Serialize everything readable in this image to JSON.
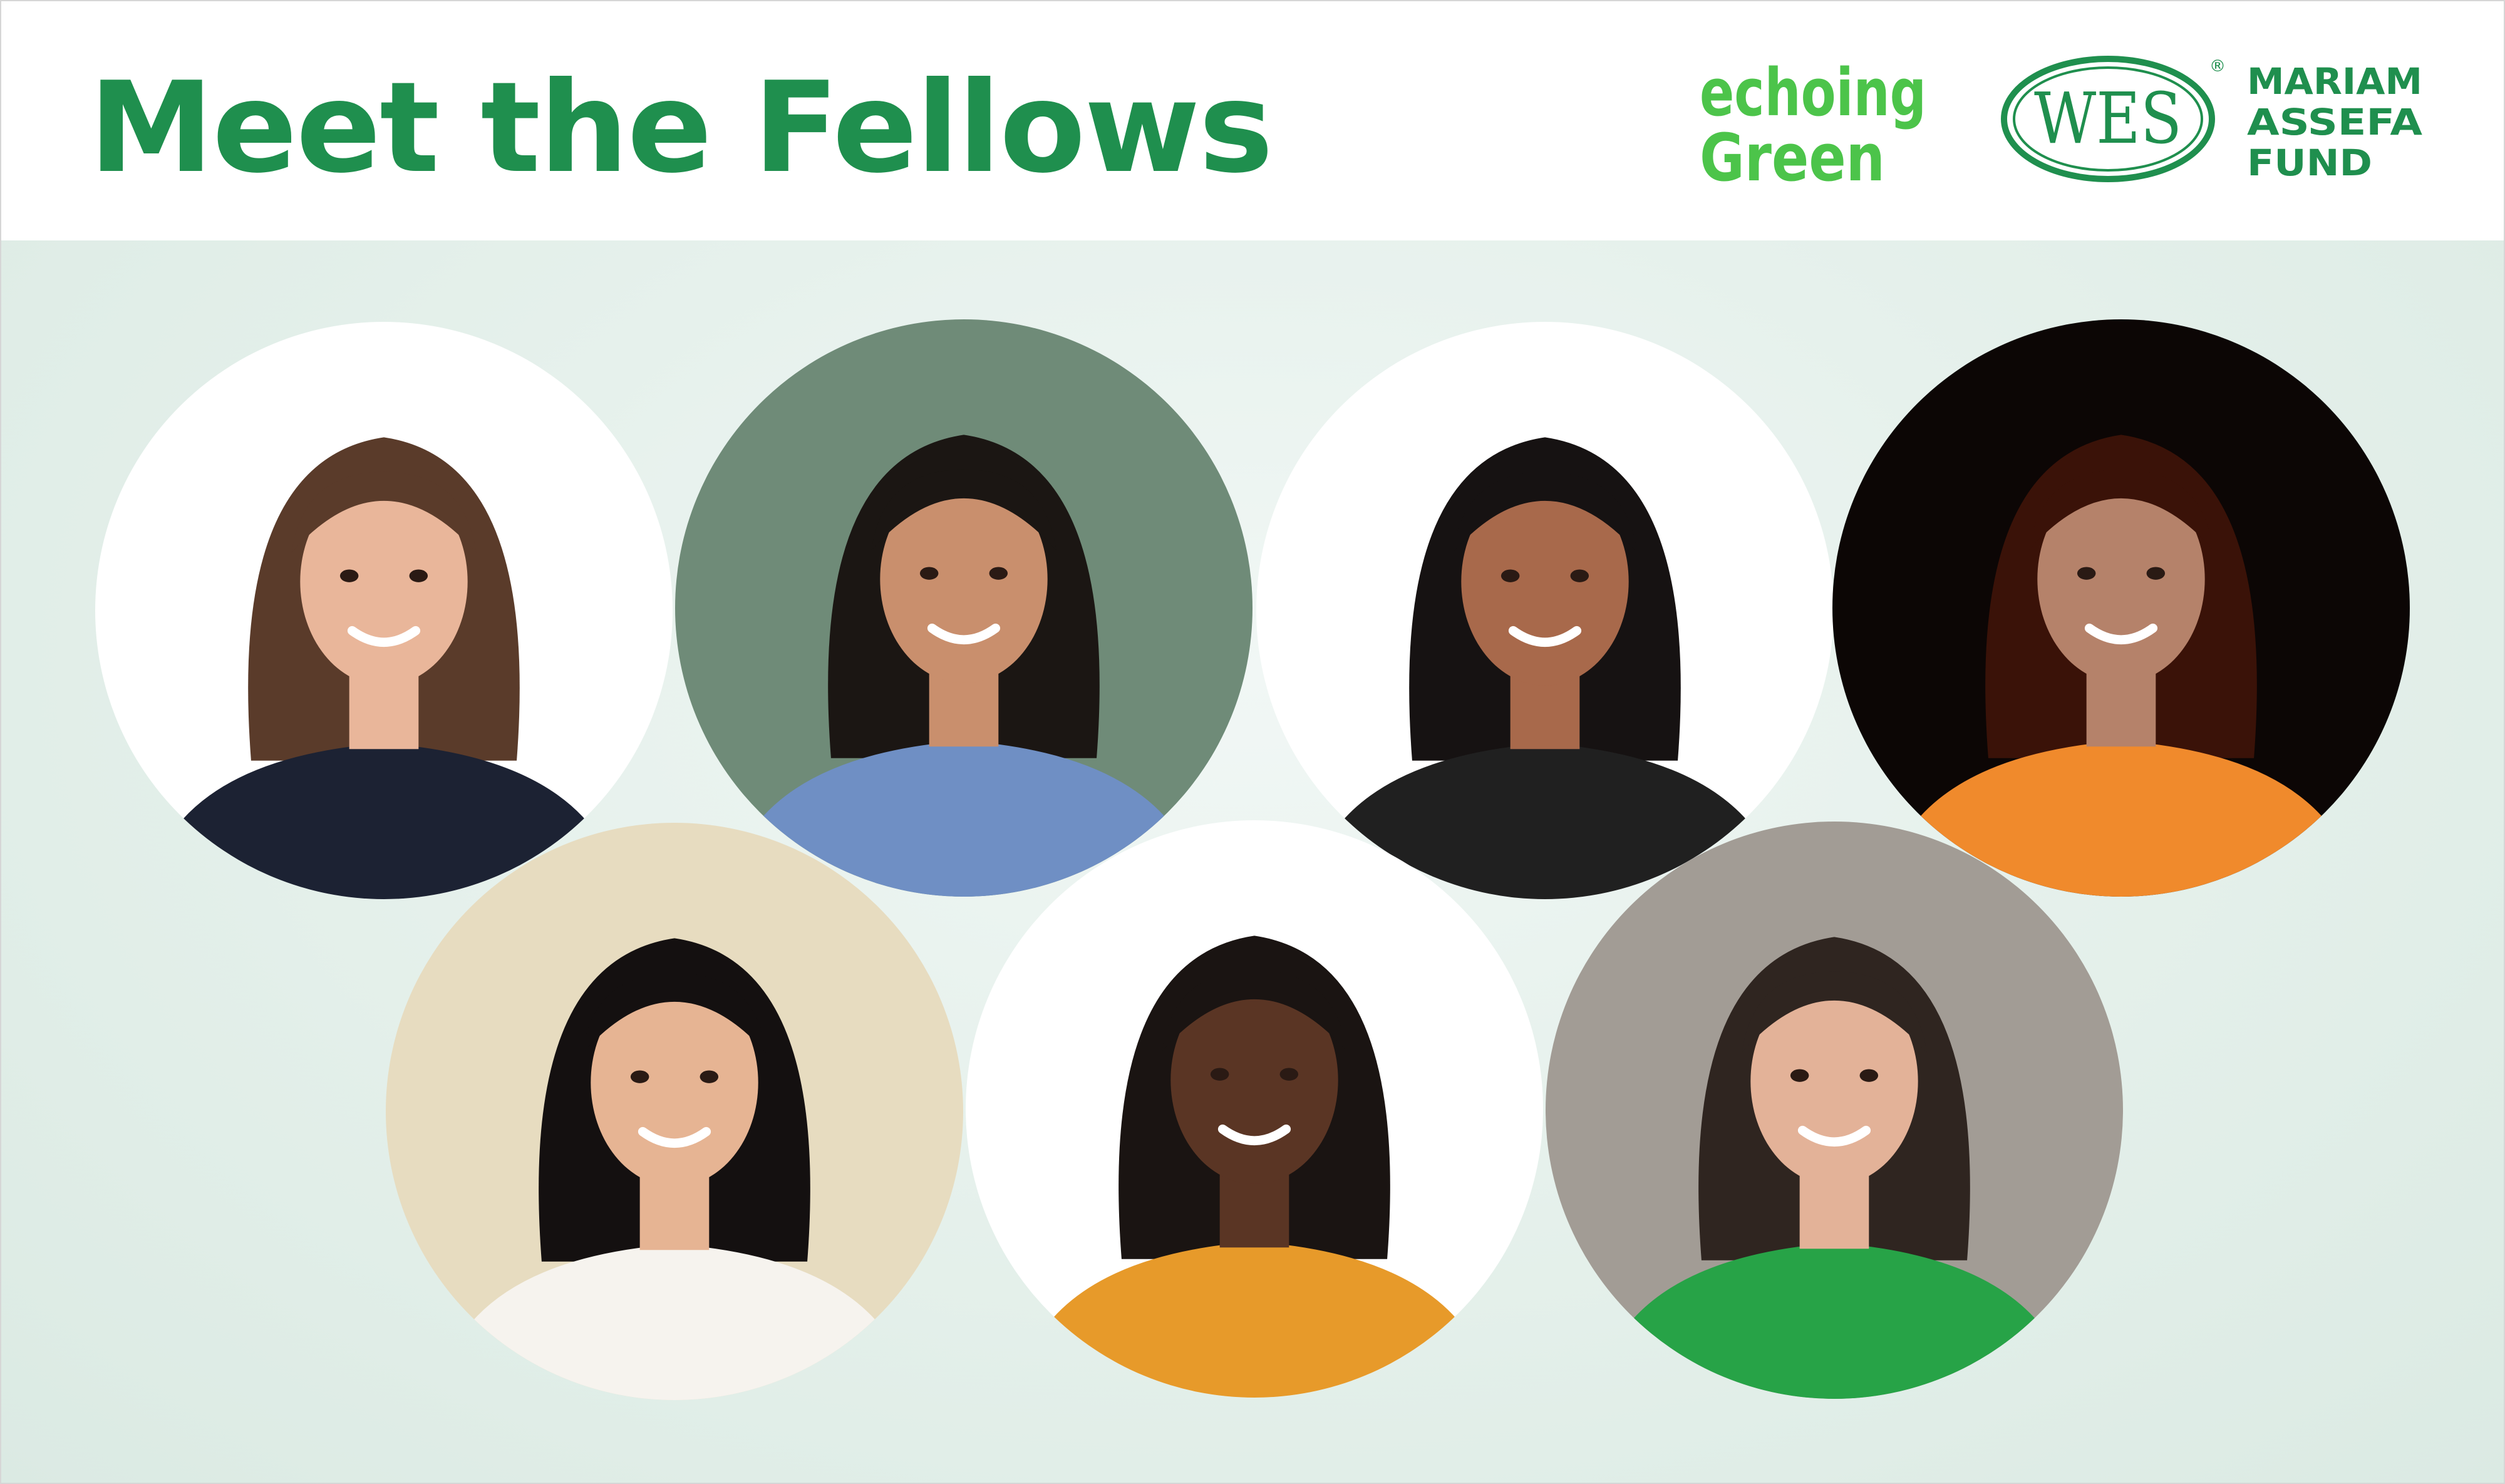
{
  "header": {
    "title": "Meet the Fellows"
  },
  "logos": {
    "echoing_green": {
      "line1": "echoing",
      "line2": "Green",
      "color": "#4cc44a"
    },
    "wes": {
      "mark": "WES",
      "registered": "®",
      "line1": "MARIAM",
      "line2": "ASSEFA",
      "line3": "FUND",
      "color": "#1f8f4e"
    }
  },
  "colors": {
    "title_green": "#1f8f4e",
    "panel_background": "#e3efe9",
    "header_background": "#ffffff"
  },
  "portraits": [
    {
      "name": "portrait-1",
      "background": "#ffffff",
      "hair": "#5a3b2a",
      "skin": "#e9b69a",
      "clothing": "#1c2233"
    },
    {
      "name": "portrait-2",
      "background": "#6f8b78",
      "hair": "#1b1613",
      "skin": "#c98f6d",
      "clothing": "#6f8fc4"
    },
    {
      "name": "portrait-3",
      "background": "#ffffff",
      "hair": "#161212",
      "skin": "#a8694b",
      "clothing": "#202020"
    },
    {
      "name": "portrait-4",
      "background": "#0c0605",
      "hair": "#3a1208",
      "skin": "#b5826a",
      "clothing": "#f08a2c"
    },
    {
      "name": "portrait-5",
      "background": "#e7dcc0",
      "hair": "#141010",
      "skin": "#e6b493",
      "clothing": "#f6f3ee"
    },
    {
      "name": "portrait-6",
      "background": "#ffffff",
      "hair": "#1a1412",
      "skin": "#5a3524",
      "clothing": "#e79a2a"
    },
    {
      "name": "portrait-7",
      "background": "#a29c95",
      "hair": "#2f2520",
      "skin": "#e3b298",
      "clothing": "#27a347"
    }
  ]
}
